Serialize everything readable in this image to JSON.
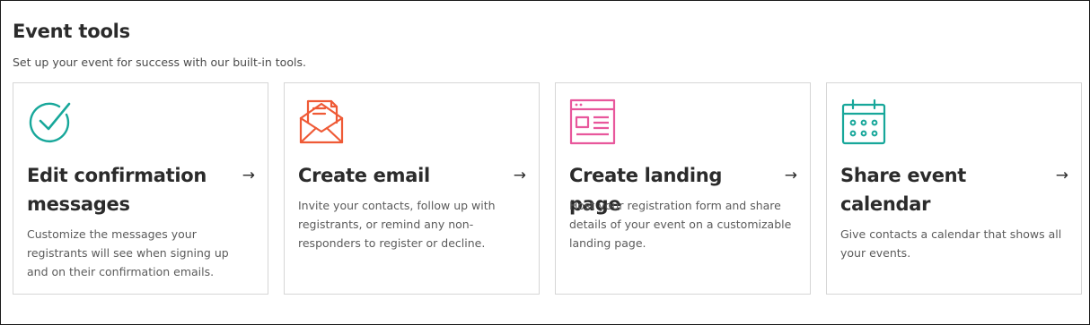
{
  "section": {
    "title": "Event tools",
    "subtitle": "Set up your event for success with our built-in tools."
  },
  "cards": [
    {
      "icon": "check-circle-icon",
      "icon_color": "#17a79a",
      "title": "Edit confirmation messages",
      "arrow": "→",
      "description": "Customize the messages your registrants will see when signing up and on their confirmation emails."
    },
    {
      "icon": "envelope-letter-icon",
      "icon_color": "#ef5a36",
      "title": "Create email",
      "arrow": "→",
      "description": "Invite your contacts, follow up with registrants, or remind any non-responders to register or decline."
    },
    {
      "icon": "browser-window-icon",
      "icon_color": "#e8579c",
      "title": "Create landing page",
      "arrow": "→",
      "description": "Host your registration form and share details of your event on a customizable landing page."
    },
    {
      "icon": "calendar-icon",
      "icon_color": "#17a79a",
      "title": "Share event calendar",
      "arrow": "→",
      "description": "Give contacts a calendar that shows all your events."
    }
  ]
}
